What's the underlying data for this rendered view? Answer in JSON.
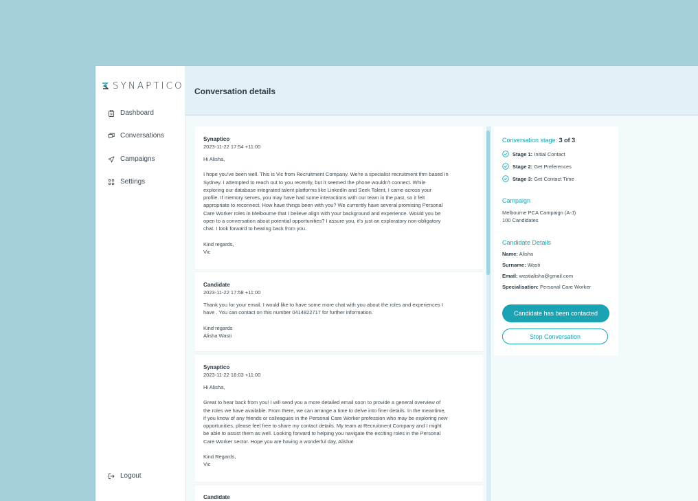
{
  "brand": {
    "name": "SYNAPTICO"
  },
  "nav": {
    "dashboard": "Dashboard",
    "conversations": "Conversations",
    "campaigns": "Campaigns",
    "settings": "Settings",
    "logout": "Logout"
  },
  "header": {
    "title": "Conversation details"
  },
  "messages": [
    {
      "sender": "Synaptico",
      "timestamp": "2023-11-22 17:54 +11:00",
      "greeting": "Hi Alisha,",
      "lines": [
        "I hope you've been well. This is Vic from Recruitment Company. We're a specialist recruitment firm based in",
        "Sydney. I attempted to reach out to you recently, but it seemed the phone wouldn't connect. While",
        "exploring our database integrated talent platforms like LinkedIn and Seek Talent, I came across your",
        "profile. If memory serves, you may have had some interactions with our team in the past, so it felt",
        "appropriate to reconnect. How have things been with you? We currently have several promising Personal",
        "Care Worker roles in Melbourne that I believe align with your background and experience. Would you be",
        "open to a conversation about potential opportunities? I assure you, it's just an exploratory non-obligatory",
        "chat. I look forward to hearing back from you."
      ],
      "signoff": "Kind regards,",
      "signature": "Vic"
    },
    {
      "sender": "Candidate",
      "timestamp": "2023-11-22 17:58 +11:00",
      "lines": [
        "Thank you for your email. I would like to have some more chat with you about the roles and experiences I",
        "have . You can contact on this number 0414822717 for further information."
      ],
      "signoff": "Kind regards",
      "signature": "Alisha Wasti"
    },
    {
      "sender": "Synaptico",
      "timestamp": "2023-11-22 18:03 +11:00",
      "greeting": "Hi Alisha,",
      "lines": [
        "Great to hear back from you! I will send you a more detailed email soon to provide a general overview of",
        "the roles we have available. From there, we can arrange a time to delve into finer details. In the meantime,",
        "if you know of any friends or colleagues in the Personal Care Worker profession who may be exploring new",
        "opportunities, please feel free to share my contact details. My team at Recruitment Company and I might",
        "be able to assist them as well. Looking forward to helping you navigate the exciting roles in the Personal",
        "Care Worker sector. Hope you are having a wonderful day, Alisha!"
      ],
      "signoff": "Kind Regards,",
      "signature": "Vic"
    },
    {
      "sender": "Candidate"
    }
  ],
  "panel": {
    "stage_label": "Conversation stage:",
    "stage_value": "3 of 3",
    "stages": [
      {
        "label": "Stage 1:",
        "name": "Initial Contact"
      },
      {
        "label": "Stage 2:",
        "name": "Get Preferences"
      },
      {
        "label": "Stage 3:",
        "name": "Get Contact Time"
      }
    ],
    "campaign_heading": "Campaign",
    "campaign_name": "Melbourne PCA Campaign (A-J)",
    "campaign_count": "100 Candidates",
    "details_heading": "Candidate Details",
    "details": [
      {
        "label": "Name:",
        "value": "Alisha"
      },
      {
        "label": "Surname:",
        "value": "Wasti"
      },
      {
        "label": "Email:",
        "value": "wastialisha@gmail.com"
      },
      {
        "label": "Specialisation:",
        "value": "Personal Care Worker"
      }
    ],
    "contacted_button": "Candidate has been contacted",
    "stop_button": "Stop Conversation"
  },
  "colors": {
    "accent": "#1aa3b3",
    "background": "#a4cfdb",
    "header": "#e3f1f6"
  }
}
